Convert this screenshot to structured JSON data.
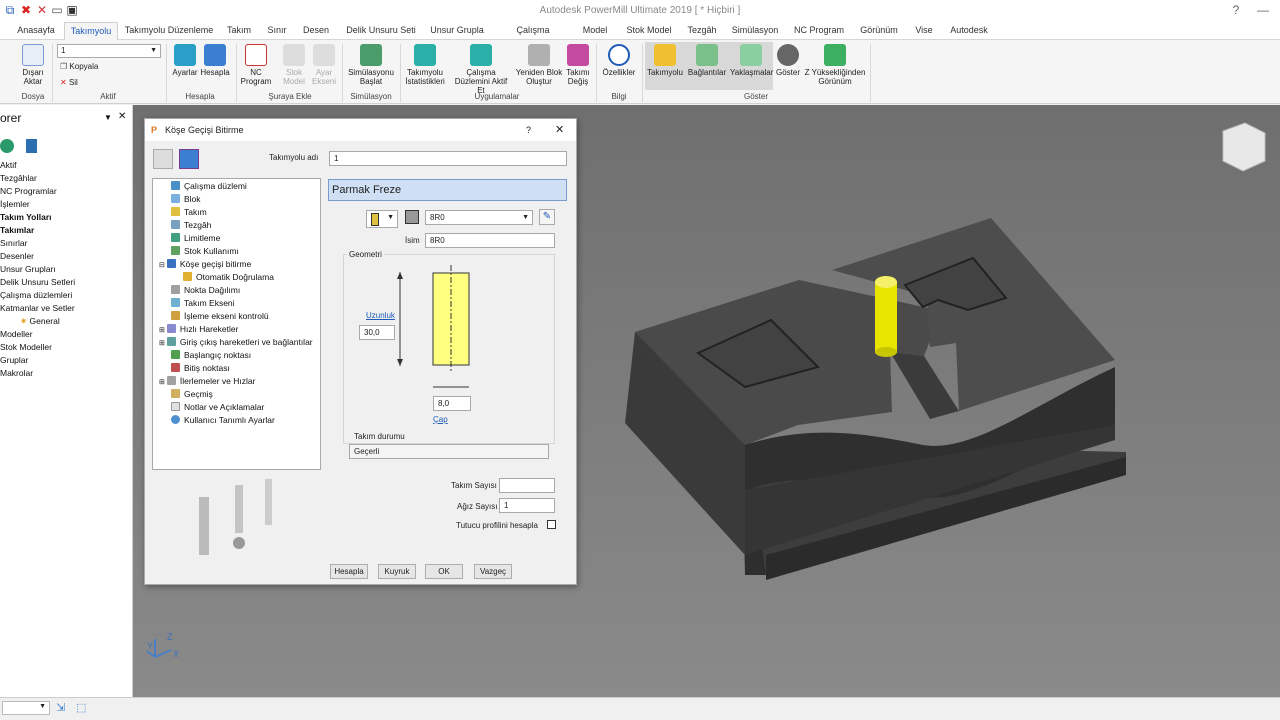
{
  "app": {
    "title": "Autodesk PowerMill Ultimate 2019 [ * Hiçbiri ]"
  },
  "ribbon_tabs": [
    "Anasayfa",
    "Takımyolu",
    "Takımyolu Düzenleme",
    "Takım",
    "Sınır",
    "Desen",
    "Delik Unsuru Seti",
    "Unsur Grupla",
    "Çalışma düzlemi",
    "Model",
    "Stok Model",
    "Tezgâh",
    "Simülasyon",
    "NC Program",
    "Görünüm",
    "Vise",
    "Autodesk"
  ],
  "ribbon": {
    "dosya": {
      "label": "Dosya",
      "button": "Dışarı Aktar"
    },
    "aktif": {
      "label": "Aktif",
      "select": "1",
      "copy": "Kopyala",
      "delete": "Sil"
    },
    "hesapla": {
      "label": "Hesapla",
      "ayarlar": "Ayarlar",
      "hesapla": "Hesapla"
    },
    "suraya": {
      "label": "Şuraya Ekle",
      "nc": "NC Program",
      "stok": "Stok Model",
      "ayar": "Ayar Ekseni"
    },
    "simulasyon": {
      "label": "Simülasyon",
      "start": "Simülasyonu Başlat"
    },
    "uygulamalar": {
      "label": "Uygulamalar",
      "stats": "Takımyolu İstatistikleri",
      "cd": "Çalışma Düzlemini Aktif Et",
      "stok": "Yeniden Blok Oluştur",
      "degis": "Takımı Değiş"
    },
    "bilgi": {
      "label": "Bilgi",
      "ozellikler": "Özellikler"
    },
    "goster": {
      "label": "Göster",
      "takimyolu": "Takımyolu",
      "baglantilar": "Bağlantılar",
      "yaklasmalar": "Yaklaşmalar",
      "goster": "Göster",
      "z": "Z Yüksekliğinden Görünüm"
    }
  },
  "explorer": {
    "title": "orer",
    "items": [
      "Aktif",
      "Tezgâhlar",
      "NC Programlar",
      "İşlemler",
      "Takım Yolları",
      "Takımlar",
      "Sınırlar",
      "Desenler",
      "Unsur Grupları",
      "Delik Unsuru Setleri",
      "Çalışma düzlemleri",
      "Katmanlar ve Setler",
      "General",
      "Modeller",
      "Stok Modeller",
      "Gruplar",
      "Makrolar"
    ]
  },
  "dialog": {
    "title": "Köşe Geçişi Bitirme",
    "help": "?",
    "close": "✕",
    "toolpath_name_label": "Takımyolu adı",
    "toolpath_name": "1",
    "tree": [
      "Çalışma düzlemi",
      "Blok",
      "Takım",
      "Tezgâh",
      "Limitleme",
      "Stok Kullanımı",
      "Köşe geçişi bitirme",
      "Otomatik Doğrulama",
      "Nokta Dağılımı",
      "Takım Ekseni",
      "İşleme ekseni kontrolü",
      "Hızlı Hareketler",
      "Giriş çıkış hareketleri ve bağlantılar",
      "Başlangıç noktası",
      "Bitiş noktası",
      "İlerlemeler ve Hızlar",
      "Geçmiş",
      "Notlar ve Açıklamalar",
      "Kullanıcı Tanımlı Ayarlar"
    ],
    "panel_header": "Parmak Freze",
    "tool_select": "8R0",
    "name_label": "İsim",
    "name": "8R0",
    "geometry_label": "Geometri",
    "length_label": "Uzunluk",
    "length": "30,0",
    "diameter_label": "Çap",
    "diameter": "8,0",
    "tool_state_label": "Takım durumu",
    "tool_state": "Geçerli",
    "tool_count_label": "Takım Sayısı",
    "tool_count": "",
    "flute_label": "Ağız Sayısı",
    "flutes": "1",
    "holder_label": "Tutucu profilini hesapla",
    "buttons": {
      "hesapla": "Hesapla",
      "kuyruk": "Kuyruk",
      "ok": "OK",
      "vazgec": "Vazgeç"
    }
  },
  "colors": {
    "accent": "#1e5bb8",
    "tool": "#f5f06a",
    "part": "#4a4a4a",
    "viewport": "#777777"
  }
}
